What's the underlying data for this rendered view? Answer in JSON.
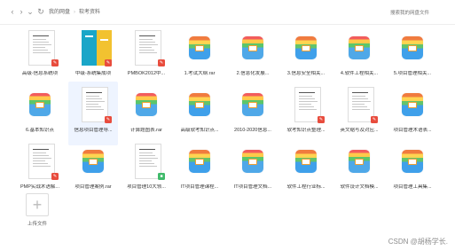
{
  "toolbar": {
    "back": "‹",
    "forward": "›",
    "dropdown": "⌄",
    "refresh": "↻",
    "breadcrumb": [
      "我的网盘",
      "软考资料"
    ],
    "search_placeholder": "搜索我的网盘文件"
  },
  "files": [
    {
      "name": "高级-信息系统项",
      "type": "doc-pdf"
    },
    {
      "name": "中级-系统集成项",
      "type": "book-pdf"
    },
    {
      "name": "PMBOK2012中...",
      "type": "doc-pdf"
    },
    {
      "name": "1.考试大纲.rar",
      "type": "app"
    },
    {
      "name": "2.信息化发展...",
      "type": "app"
    },
    {
      "name": "3.信息安全相关...",
      "type": "app"
    },
    {
      "name": "4.软件工程相关...",
      "type": "app"
    },
    {
      "name": "5.项目管理相关...",
      "type": "app"
    },
    {
      "name": "6.基本知识点",
      "type": "app"
    },
    {
      "name": "信息项目管理导...",
      "type": "doc-pdf"
    },
    {
      "name": "计算题图表.rar",
      "type": "app"
    },
    {
      "name": "高级软考知识点...",
      "type": "app"
    },
    {
      "name": "2010-2020信息...",
      "type": "app"
    },
    {
      "name": "软考知识点整理...",
      "type": "doc-pdf"
    },
    {
      "name": "英文缩写及对应...",
      "type": "doc-pdf"
    },
    {
      "name": "项目管理术语表...",
      "type": "app"
    },
    {
      "name": "PMP实战术语解...",
      "type": "doc-pdf"
    },
    {
      "name": "项目管理案例.rar",
      "type": "app"
    },
    {
      "name": "项目管理10大领...",
      "type": "doc-green"
    },
    {
      "name": "IT项目管理课程...",
      "type": "app"
    },
    {
      "name": "IT项目管理文档...",
      "type": "app"
    },
    {
      "name": "软件工程行业标...",
      "type": "app"
    },
    {
      "name": "软件设计文档模...",
      "type": "app"
    },
    {
      "name": "项目管理工具集...",
      "type": "app"
    }
  ],
  "upload": {
    "label": "上传文件",
    "icon": "+"
  },
  "watermark": "CSDN @胡杨学长."
}
